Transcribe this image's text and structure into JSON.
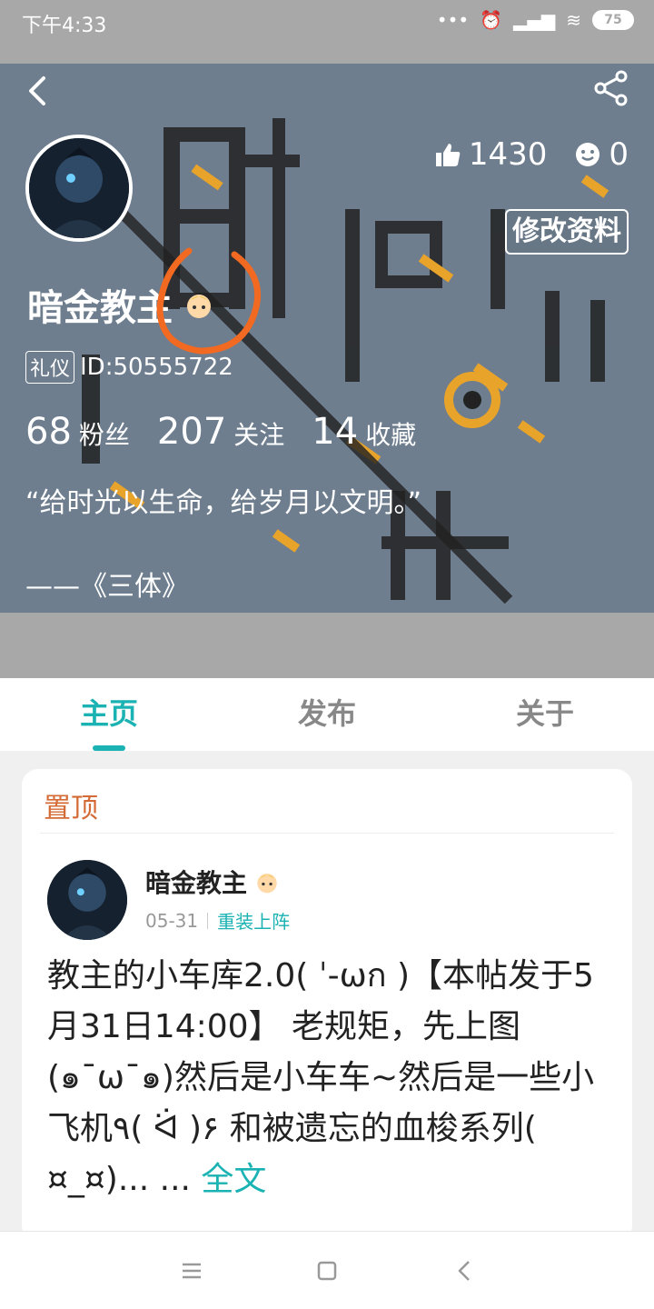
{
  "status_bar": {
    "time": "下午4:33",
    "battery": "75"
  },
  "profile": {
    "username": "暗金教主",
    "tag": "礼仪",
    "id_text": "ID:50555722",
    "likes": "1430",
    "smiles": "0",
    "edit_label": "修改资料",
    "fans_count": "68",
    "fans_label": "粉丝",
    "following_count": "207",
    "following_label": "关注",
    "favorites_count": "14",
    "favorites_label": "收藏",
    "signature_line1": "“给时光以生命，给岁月以文明。”",
    "signature_line2": "——《三体》"
  },
  "tabs": [
    {
      "label": "主页",
      "active": true
    },
    {
      "label": "发布",
      "active": false
    },
    {
      "label": "关于",
      "active": false
    }
  ],
  "pinned": {
    "section_label": "置顶",
    "author": "暗金教主",
    "date": "05-31",
    "category": "重装上阵",
    "body": "教主的小车库2.0( ˈ-ωก )【本帖发于5月31日14:00】 老规矩，先上图(๑¯ω¯๑)然后是小车车~然后是一些小飞机٩( ᐛ )۶ 和被遗忘的血梭系列( ¤_¤)... ...",
    "more_label": "全文"
  },
  "colors": {
    "accent": "#1ab2b2",
    "pin": "#d46a35",
    "hero_bg": "#6f7f8f",
    "annotation": "#f26a22"
  },
  "icons": [
    "back-arrow-icon",
    "share-icon",
    "thumbs-up-icon",
    "smile-icon",
    "menu-icon",
    "home-square-icon",
    "back-triangle-icon"
  ]
}
